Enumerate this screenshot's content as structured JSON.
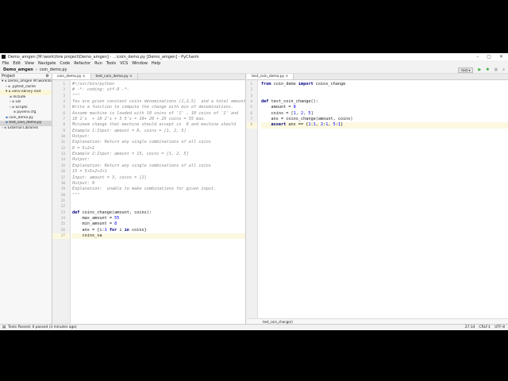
{
  "window": {
    "title": "Demo_amgen [M:\\work\\fore project\\Demo_amgen] - ...\\coin_demo.py [Demo_amgen] - PyCharm",
    "controls": [
      "–",
      "▢",
      "✕"
    ]
  },
  "menu": [
    "File",
    "Edit",
    "View",
    "Navigate",
    "Code",
    "Refactor",
    "Run",
    "Tools",
    "VCS",
    "Window",
    "Help"
  ],
  "breadcrumb": [
    "Demo_amgen",
    "coin_demo.py"
  ],
  "run_config": "test",
  "project": {
    "header": "Project",
    "tree": [
      {
        "label": "Demo_amgen  M:\\work\\fore",
        "indent": 0,
        "icon": "▾"
      },
      {
        "label": ".pytest_cache",
        "indent": 1,
        "icon": "›"
      },
      {
        "label": "venv  library root",
        "indent": 1,
        "icon": "▾",
        "hl": true
      },
      {
        "label": "Include",
        "indent": 2,
        "icon": ""
      },
      {
        "label": "Lib",
        "indent": 2,
        "icon": "›"
      },
      {
        "label": "Scripts",
        "indent": 2,
        "icon": "›"
      },
      {
        "label": "pyvenv.cfg",
        "indent": 3,
        "icon": ""
      },
      {
        "label": "coin_demo.py",
        "indent": 1,
        "icon": ""
      },
      {
        "label": "test_coin_demo.py",
        "indent": 1,
        "icon": "",
        "sel": true
      },
      {
        "label": "External Libraries",
        "indent": 0,
        "icon": "›"
      }
    ]
  },
  "left_editor": {
    "tabs": [
      "coin_demo.py",
      "test_coin_demo.py"
    ],
    "lines": [
      {
        "t": "#!/usr/bin/python",
        "c": "doc"
      },
      {
        "t": "# -*- coding: utf-8 -*-",
        "c": "doc"
      },
      {
        "t": "\"\"\"",
        "c": "doc"
      },
      {
        "t": "You are given constant coins denominations (1,2,5)  and a total amount",
        "c": "doc"
      },
      {
        "t": "Write a function to compute the change with min of denominations.",
        "c": "doc"
      },
      {
        "t": "Assume machine is loaded with 10 coins of '1' , 10 coins of '2' and",
        "c": "doc"
      },
      {
        "t": "10 1's  + 10 2's + 5 5's = 10+ 20 + 25 coins = 55 max.",
        "c": "doc"
      },
      {
        "t": "Minimum change that machine should accept is  8 and machine should",
        "c": "doc"
      },
      {
        "t": "Example 1:Input: amount = 8, coins = [1, 2, 5]",
        "c": "doc"
      },
      {
        "t": "Output:",
        "c": "doc"
      },
      {
        "t": "Explanation: Return any single combinations of all coins",
        "c": "doc"
      },
      {
        "t": "8 = 5+2+1",
        "c": "doc"
      },
      {
        "t": "Example 2:Input: amount = 15, coins = [1, 2, 5]",
        "c": "doc"
      },
      {
        "t": "Output:",
        "c": "doc"
      },
      {
        "t": "Explanation: Return any single combinations of all coins",
        "c": "doc"
      },
      {
        "t": "15 = 5+5+2+2+1",
        "c": "doc"
      },
      {
        "t": "Input: amount = 3, coins = [2]",
        "c": "doc"
      },
      {
        "t": "Output: 0",
        "c": "doc"
      },
      {
        "t": "Explanation:  unable to make combinations for given input.",
        "c": "doc"
      },
      {
        "t": "\"\"\"",
        "c": "doc"
      },
      {
        "t": "",
        "c": ""
      },
      {
        "t": "",
        "c": ""
      },
      {
        "t": "def coins_change(amount, coins):",
        "c": ""
      },
      {
        "t": "    max_amount = 55",
        "c": ""
      },
      {
        "t": "    min_amount = 8",
        "c": ""
      },
      {
        "t": "    ans = {i:1 for i in coins}",
        "c": ""
      },
      {
        "t": "    coins_va",
        "c": "cur"
      }
    ]
  },
  "right_editor": {
    "tabs": [
      "test_coin_demo.py"
    ],
    "lines": [
      {
        "t": "from coin_demo import coins_change",
        "c": ""
      },
      {
        "t": "",
        "c": ""
      },
      {
        "t": "",
        "c": ""
      },
      {
        "t": "def test_coin_change():",
        "c": ""
      },
      {
        "t": "    amount = 8",
        "c": ""
      },
      {
        "t": "    coins = [1, 2, 5]",
        "c": ""
      },
      {
        "t": "    ans = coins_change(amount, coins)",
        "c": ""
      },
      {
        "t": "    assert ans == {1:1, 2:1, 5:1}",
        "c": "cur"
      }
    ],
    "breadcrumb": "test_coin_change()"
  },
  "status": {
    "message": "Tests Passed: 0 passed (3 minutes ago)",
    "position": "27:14",
    "line_sep": "CRLF↕",
    "encoding": "UTF-8"
  }
}
